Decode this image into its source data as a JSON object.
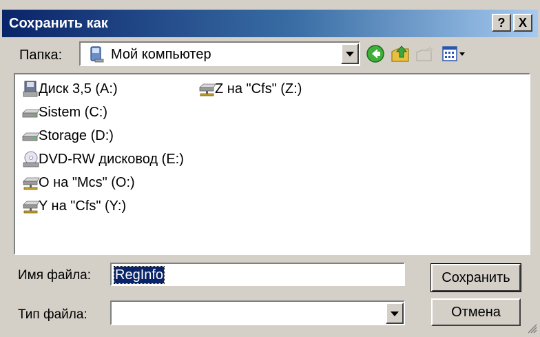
{
  "window": {
    "title": "Сохранить как",
    "help_label": "?",
    "close_label": "X"
  },
  "toolbar": {
    "folder_label": "Папка:",
    "folder_value": "Мой компьютер",
    "folder_icon": "my-computer-icon",
    "tools": [
      "back-icon",
      "up-folder-icon",
      "new-folder-icon",
      "view-menu-icon"
    ]
  },
  "file_list": {
    "items": [
      {
        "label": "Диск 3,5 (A:)",
        "icon": "floppy-drive-icon"
      },
      {
        "label": "Sistem (C:)",
        "icon": "hard-drive-icon"
      },
      {
        "label": "Storage (D:)",
        "icon": "hard-drive-icon"
      },
      {
        "label": "DVD-RW дисковод (E:)",
        "icon": "dvd-drive-icon"
      },
      {
        "label": "O на \"Mcs\" (O:)",
        "icon": "network-drive-icon"
      },
      {
        "label": "Y на \"Cfs\" (Y:)",
        "icon": "network-drive-icon"
      },
      {
        "label": "Z на \"Cfs\" (Z:)",
        "icon": "network-drive-icon"
      }
    ]
  },
  "form": {
    "filename_label": "Имя файла:",
    "filename_value": "RegInfo",
    "filetype_label": "Тип файла:",
    "filetype_value": ""
  },
  "buttons": {
    "save": "Сохранить",
    "cancel": "Отмена"
  },
  "colors": {
    "title_start": "#0a246a",
    "title_end": "#a6caf0",
    "face": "#d4d0c8",
    "selection": "#0a246a"
  }
}
